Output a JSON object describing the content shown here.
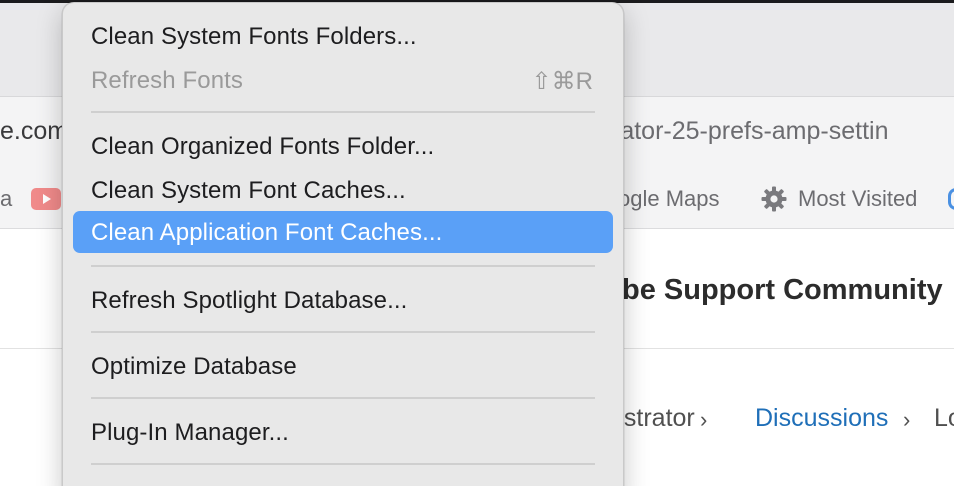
{
  "browser": {
    "url_left": "e.com",
    "url_right": "rator-25-prefs-amp-settin",
    "bookmarks": {
      "left_fragment": "a",
      "maps": "ogle Maps",
      "most_visited": "Most Visited"
    }
  },
  "page": {
    "heading": "be Support Community",
    "breadcrumb": {
      "item1": "ustrator",
      "item2": "Discussions",
      "item3": "Lo",
      "separator": "›"
    }
  },
  "menu": {
    "items": [
      {
        "label": "Clean System Fonts Folders...",
        "state": "enabled"
      },
      {
        "label": "Refresh Fonts",
        "shortcut": "⇧⌘R",
        "state": "disabled"
      },
      {
        "label": "Clean Organized Fonts Folder...",
        "state": "enabled"
      },
      {
        "label": "Clean System Font Caches...",
        "state": "enabled"
      },
      {
        "label": "Clean Application Font Caches...",
        "state": "selected"
      },
      {
        "label": "Refresh Spotlight Database...",
        "state": "enabled"
      },
      {
        "label": "Optimize Database",
        "state": "enabled"
      },
      {
        "label": "Plug-In Manager...",
        "state": "enabled"
      }
    ]
  },
  "colors": {
    "highlight": "#5aa0f7",
    "link": "#1f6fb8",
    "menu_bg": "#e8e8e8"
  }
}
